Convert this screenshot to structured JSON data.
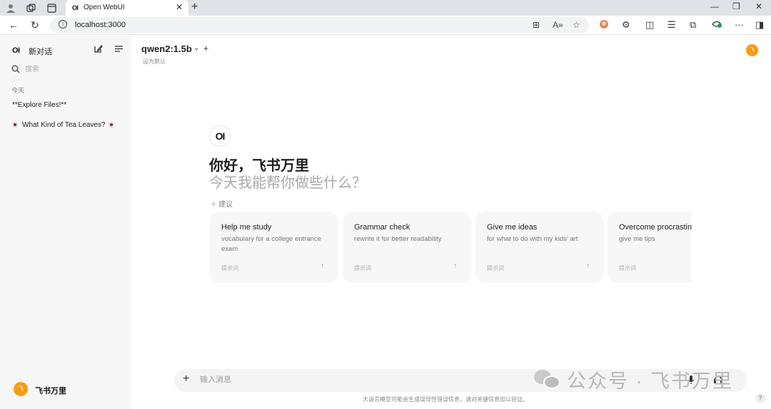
{
  "browser": {
    "tab_logo": "OI",
    "tab_title": "Open WebUI",
    "url": "localhost:3000"
  },
  "sidebar": {
    "logo": "OI",
    "new_chat": "新对话",
    "search_placeholder": "搜索",
    "section_today": "今天",
    "items": [
      {
        "label": "**Explore Files!**"
      },
      {
        "label": "What Kind of Tea Leaves?"
      }
    ],
    "user_avatar": "飞",
    "user_name": "飞书万里"
  },
  "header": {
    "model": "qwen2:1.5b",
    "set_default": "设为默认",
    "avatar": "飞"
  },
  "hero": {
    "logo": "OI",
    "greeting": "你好，飞书万里",
    "subtitle": "今天我能帮你做些什么？",
    "suggestions_label": "建议"
  },
  "suggestions": [
    {
      "title": "Help me study",
      "desc": "vocabulary for a college entrance exam",
      "foot": "提示词"
    },
    {
      "title": "Grammar check",
      "desc": "rewrite it for better readability",
      "foot": "提示词"
    },
    {
      "title": "Give me ideas",
      "desc": "for what to do with my kids' art",
      "foot": "提示词"
    },
    {
      "title": "Overcome procrastination",
      "desc": "give me tips",
      "foot": "提示词"
    }
  ],
  "input": {
    "placeholder": "输入消息"
  },
  "disclaimer": "大语言模型可能会生成误导性错误信息，请对关键信息加以验证。",
  "help": "?",
  "watermark": "公众号 · 飞书万里",
  "icons": {
    "accent": "#f59c18"
  }
}
